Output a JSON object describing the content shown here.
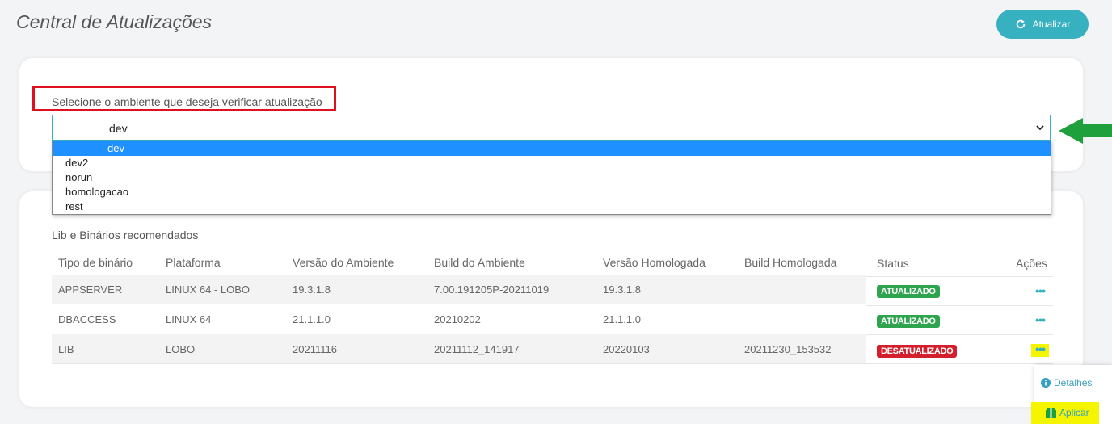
{
  "header": {
    "title": "Central de Atualizações",
    "refresh_label": "Atualizar"
  },
  "environment": {
    "label": "Selecione o ambiente que deseja verificar atualização",
    "selected": "dev",
    "options": [
      "dev",
      "dev2",
      "norun",
      "homologacao",
      "rest"
    ]
  },
  "section": {
    "title": "Lib e Binários recomendados"
  },
  "table": {
    "columns": [
      "Tipo de binário",
      "Plataforma",
      "Versão do Ambiente",
      "Build do Ambiente",
      "Versão Homologada",
      "Build Homologada",
      "Status",
      "Ações"
    ],
    "rows": [
      {
        "tipo": "APPSERVER",
        "plataforma": "LINUX 64 - LOBO",
        "versao_ambiente": "19.3.1.8",
        "build_ambiente": "7.00.191205P-20211019",
        "versao_homologada": "19.3.1.8",
        "build_homologada": "",
        "status": "ATUALIZADO"
      },
      {
        "tipo": "DBACCESS",
        "plataforma": "LINUX 64",
        "versao_ambiente": "21.1.1.0",
        "build_ambiente": "20210202",
        "versao_homologada": "21.1.1.0",
        "build_homologada": "",
        "status": "ATUALIZADO"
      },
      {
        "tipo": "LIB",
        "plataforma": "LOBO",
        "versao_ambiente": "20211116",
        "build_ambiente": "20211112_141917",
        "versao_homologada": "20220103",
        "build_homologada": "20211230_153532",
        "status": "DESATUALIZADO"
      }
    ],
    "actions_glyph": "•••"
  },
  "actions_menu": {
    "details_label": "Detalhes",
    "apply_label": "Aplicar"
  },
  "colors": {
    "accent": "#37b0c0",
    "ok": "#2fa44f",
    "bad": "#d21f2b",
    "highlight": "#f5f500",
    "annotation_red": "#e0101e",
    "annotation_green": "#1ea03c"
  }
}
